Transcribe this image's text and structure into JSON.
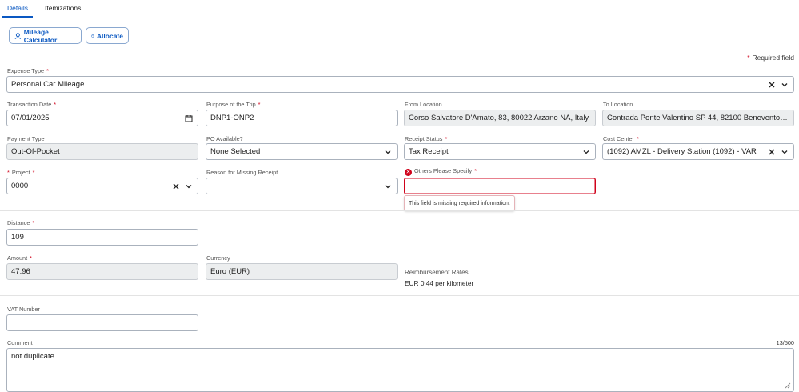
{
  "tabs": {
    "details": "Details",
    "itemizations": "Itemizations"
  },
  "buttons": {
    "mileage_calculator": "Mileage Calculator",
    "allocate": "Allocate"
  },
  "required_note": "Required field",
  "fields": {
    "expense_type": {
      "label": "Expense Type",
      "value": "Personal Car Mileage"
    },
    "transaction_date": {
      "label": "Transaction Date",
      "value": "07/01/2025"
    },
    "purpose": {
      "label": "Purpose of the Trip",
      "value": "DNP1-ONP2"
    },
    "from_location": {
      "label": "From Location",
      "value": "Corso Salvatore D'Amato, 83, 80022 Arzano NA, Italy"
    },
    "to_location": {
      "label": "To Location",
      "value": "Contrada Ponte Valentino SP 44, 82100 Benevento B ..."
    },
    "payment_type": {
      "label": "Payment Type",
      "value": "Out-Of-Pocket"
    },
    "po_available": {
      "label": "PO Available?",
      "value": "None Selected"
    },
    "receipt_status": {
      "label": "Receipt Status",
      "value": "Tax Receipt"
    },
    "cost_center": {
      "label": "Cost Center",
      "value": "(1092) AMZL - Delivery Station (1092) - VAR"
    },
    "project": {
      "label": "Project",
      "value": "0000"
    },
    "missing_receipt_reason": {
      "label": "Reason for Missing Receipt",
      "value": ""
    },
    "others_specify": {
      "label": "Others Please Specify",
      "value": "",
      "error": "This field is missing required information."
    },
    "distance": {
      "label": "Distance",
      "value": "109"
    },
    "amount": {
      "label": "Amount",
      "value": "47.96"
    },
    "currency": {
      "label": "Currency",
      "value": "Euro (EUR)"
    },
    "vat_number": {
      "label": "VAT Number",
      "value": ""
    },
    "comment": {
      "label": "Comment",
      "value": "not duplicate",
      "counter": "13/500"
    }
  },
  "reimbursement": {
    "label": "Reimbursement Rates",
    "value": "EUR 0.44 per kilometer"
  },
  "colors": {
    "accent": "#0a58c2",
    "error": "#d0021b"
  }
}
